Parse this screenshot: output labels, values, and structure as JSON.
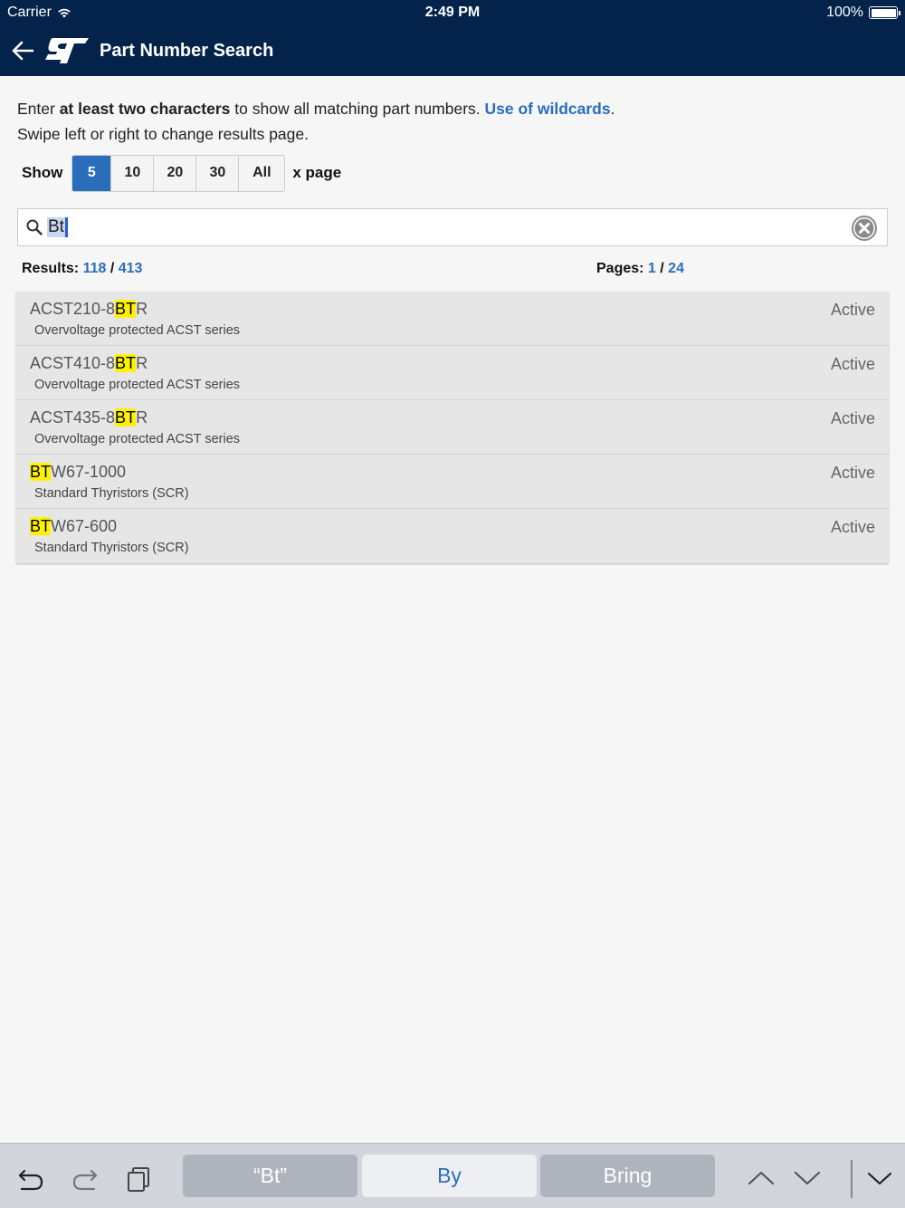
{
  "status_bar": {
    "carrier": "Carrier",
    "time": "2:49 PM",
    "battery": "100%"
  },
  "header": {
    "title": "Part Number Search",
    "logo_text": "ST",
    "bg_color": "#03234b"
  },
  "intro": {
    "line1_prefix": "Enter ",
    "line1_bold": "at least two characters",
    "line1_suffix": " to show all matching part numbers. ",
    "wildcards_link": "Use of wildcards",
    "line1_end": ".",
    "line2": "Swipe left or right to change results page."
  },
  "page_size": {
    "label": "Show",
    "options": [
      "5",
      "10",
      "20",
      "30",
      "All"
    ],
    "selected": "5",
    "suffix": "x page"
  },
  "search": {
    "value": "Bt"
  },
  "counts": {
    "results_label": "Results:",
    "results_shown": "118",
    "results_sep": " / ",
    "results_total": "413",
    "pages_label": "Pages:",
    "page_current": "1",
    "pages_sep": " / ",
    "pages_total": "24"
  },
  "results": [
    {
      "pre": "ACST210-8",
      "match": "BT",
      "post": "R",
      "desc": "Overvoltage protected ACST series",
      "status": "Active"
    },
    {
      "pre": "ACST410-8",
      "match": "BT",
      "post": "R",
      "desc": "Overvoltage protected ACST series",
      "status": "Active"
    },
    {
      "pre": "ACST435-8",
      "match": "BT",
      "post": "R",
      "desc": "Overvoltage protected ACST series",
      "status": "Active"
    },
    {
      "pre": "",
      "match": "BT",
      "post": "W67-1000",
      "desc": "Standard Thyristors (SCR)",
      "status": "Active"
    },
    {
      "pre": "",
      "match": "BT",
      "post": "W67-600",
      "desc": "Standard Thyristors (SCR)",
      "status": "Active"
    }
  ],
  "keyboard_bar": {
    "suggestions": [
      "“Bt”",
      "By",
      "Bring"
    ],
    "icons": [
      "undo-icon",
      "redo-icon",
      "paste-icon",
      "chevron-up-icon",
      "chevron-down-icon",
      "dismiss-keyboard-icon"
    ]
  },
  "colors": {
    "accent": "#2a6ebb",
    "highlight": "#fff200"
  }
}
